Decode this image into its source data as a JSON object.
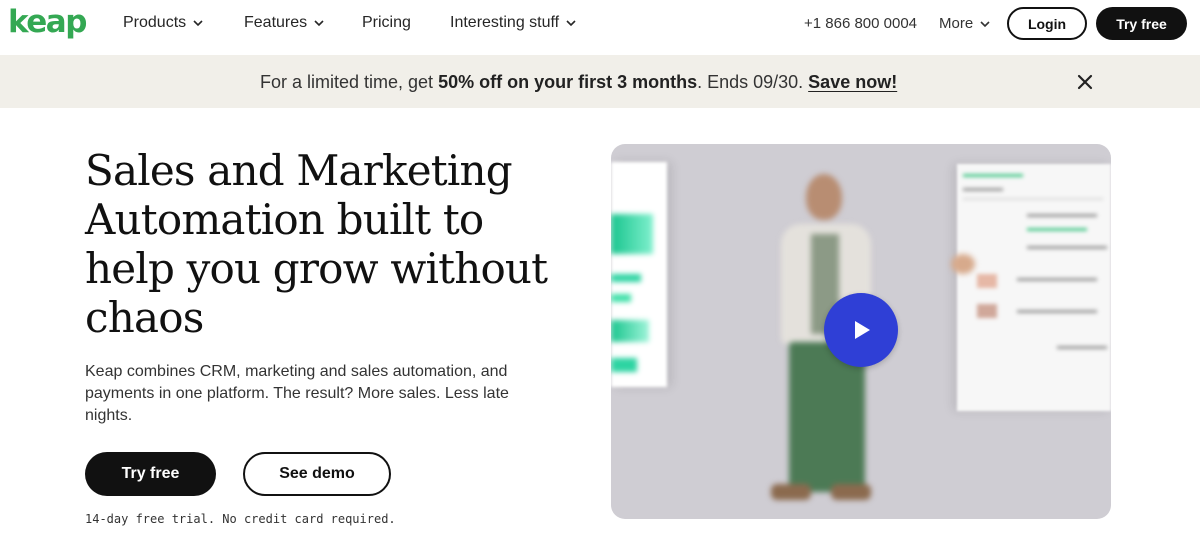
{
  "brand": {
    "logo_text": "keap",
    "color": "#34a853"
  },
  "nav": {
    "products": "Products",
    "features": "Features",
    "pricing": "Pricing",
    "interesting": "Interesting stuff",
    "phone": "+1 866 800 0004",
    "more": "More",
    "login": "Login",
    "try_free": "Try free"
  },
  "banner": {
    "prefix": "For a limited time, get ",
    "highlight": "50% off on your first 3 months",
    "suffix": ". Ends 09/30. ",
    "link": "Save now!",
    "close_icon": "close-icon"
  },
  "hero": {
    "title": "Sales and Marketing Automation built to help you grow without chaos",
    "description": "Keap combines CRM, marketing and sales automation, and payments in one platform. The result? More sales. Less late nights.",
    "primary_cta": "Try free",
    "secondary_cta": "See demo",
    "note": "14-day free trial. No credit card required."
  },
  "video": {
    "play_icon": "play-icon",
    "play_color": "#2f3fd6",
    "accent_color": "#2dd4a2"
  }
}
